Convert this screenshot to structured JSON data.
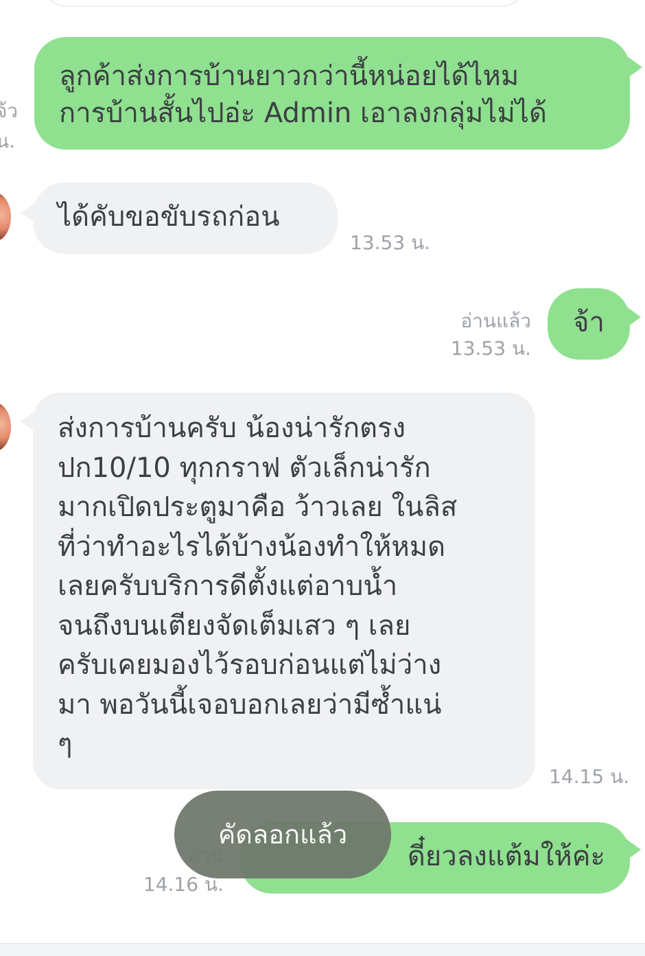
{
  "messages": [
    {
      "direction": "out",
      "lines": [
        "ลูกค้าส่งการบ้านยาวกว่านี้หน่อยได้ไหม",
        "การบ้านสั้นไปอ่ะ Admin เอาลงกลุ่มไม่ได้"
      ],
      "meta_partial": [
        "จ้ว",
        "น."
      ]
    },
    {
      "direction": "in",
      "text": "ได้คับขอขับรถก่อน",
      "time": "13.53 น."
    },
    {
      "direction": "out",
      "text": "จ้า",
      "read": "อ่านแล้ว",
      "time": "13.53 น."
    },
    {
      "direction": "in",
      "lines": [
        "ส่งการบ้านครับ น้องน่ารักตรง",
        "ปก10/10 ทุกกราฟ ตัวเล็กน่ารัก",
        "มากเปิดประตูมาคือ ว้าวเลย ในลิส",
        "ที่ว่าทำอะไรได้บ้างน้องทำให้หมด",
        "เลยครับบริการดีตั้งแต่อาบน้ำ",
        "จนถึงบนเตียงจัดเต็มเสว ๆ เลย",
        "ครับเคยมองไว้รอบก่อนแต่ไม่ว่าง",
        "มา พอวันนี้เจอบอกเลยว่ามีซ้ำแน่",
        "ๆ"
      ],
      "time": "14.15 น."
    },
    {
      "direction": "out",
      "text_visible": "ดี๋ยวลงแต้มให้ค่ะ",
      "read_partial": "อ่าน",
      "time": "14.16 น."
    }
  ],
  "toast": {
    "text": "คัดลอกแล้ว"
  },
  "colors": {
    "outgoing_bubble": "#8fe08f",
    "incoming_bubble": "#f0f1f3",
    "meta_text": "#9ea2a8",
    "toast_bg": "#6e766a"
  }
}
